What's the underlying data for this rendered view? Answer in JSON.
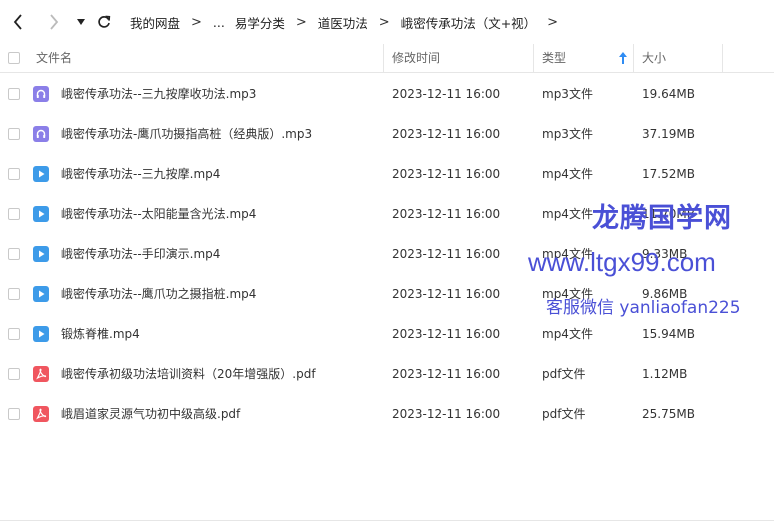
{
  "breadcrumb": [
    "我的网盘",
    "...",
    "易学分类",
    "道医功法",
    "峨密传承功法（文+视）"
  ],
  "columns": {
    "name": "文件名",
    "modified": "修改时间",
    "type": "类型",
    "size": "大小"
  },
  "files": [
    {
      "name": "峨密传承功法--三九按摩收功法.mp3",
      "modified": "2023-12-11 16:00",
      "type": "mp3文件",
      "size": "19.64MB",
      "icon": "audio-file-icon"
    },
    {
      "name": "峨密传承功法-鹰爪功摄指高桩（经典版）.mp3",
      "modified": "2023-12-11 16:00",
      "type": "mp3文件",
      "size": "37.19MB",
      "icon": "audio-file-icon"
    },
    {
      "name": "峨密传承功法--三九按摩.mp4",
      "modified": "2023-12-11 16:00",
      "type": "mp4文件",
      "size": "17.52MB",
      "icon": "video-file-icon"
    },
    {
      "name": "峨密传承功法--太阳能量含光法.mp4",
      "modified": "2023-12-11 16:00",
      "type": "mp4文件",
      "size": "11.70MB",
      "icon": "video-file-icon"
    },
    {
      "name": "峨密传承功法--手印演示.mp4",
      "modified": "2023-12-11 16:00",
      "type": "mp4文件",
      "size": "9.33MB",
      "icon": "video-file-icon"
    },
    {
      "name": "峨密传承功法--鹰爪功之摄指桩.mp4",
      "modified": "2023-12-11 16:00",
      "type": "mp4文件",
      "size": "9.86MB",
      "icon": "video-file-icon"
    },
    {
      "name": "锻炼脊椎.mp4",
      "modified": "2023-12-11 16:00",
      "type": "mp4文件",
      "size": "15.94MB",
      "icon": "video-file-icon"
    },
    {
      "name": "峨密传承初级功法培训资料（20年增强版）.pdf",
      "modified": "2023-12-11 16:00",
      "type": "pdf文件",
      "size": "1.12MB",
      "icon": "pdf-file-icon"
    },
    {
      "name": "峨眉道家灵源气功初中级高级.pdf",
      "modified": "2023-12-11 16:00",
      "type": "pdf文件",
      "size": "25.75MB",
      "icon": "pdf-file-icon"
    }
  ],
  "watermark": {
    "line1": "龙腾国学网",
    "line2": "www.ltgx99.com",
    "line3": "客服微信 yanliaofan225"
  },
  "colors": {
    "audio": "#8b7fe8",
    "video": "#3d9be9",
    "pdf": "#f0565f",
    "watermark": "#4a50d6",
    "sort_arrow": "#2f8cf3"
  }
}
